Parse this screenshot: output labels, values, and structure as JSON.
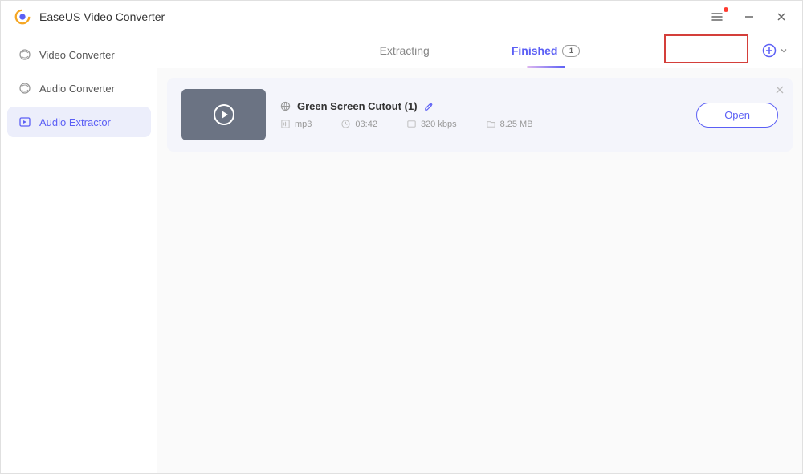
{
  "app": {
    "title": "EaseUS Video Converter"
  },
  "sidebar": {
    "items": [
      {
        "label": "Video Converter"
      },
      {
        "label": "Audio Converter"
      },
      {
        "label": "Audio Extractor"
      }
    ],
    "activeIndex": 2
  },
  "tabs": {
    "extracting": {
      "label": "Extracting"
    },
    "finished": {
      "label": "Finished",
      "count": "1"
    },
    "active": "finished"
  },
  "item": {
    "title": "Green Screen Cutout (1)",
    "format": "mp3",
    "duration": "03:42",
    "bitrate": "320 kbps",
    "size": "8.25 MB",
    "openLabel": "Open"
  }
}
